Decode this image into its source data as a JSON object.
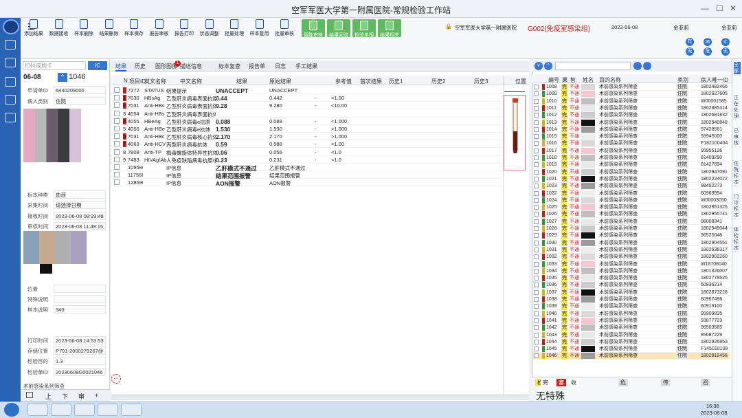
{
  "window": {
    "title": "空军军医大学第一附属医院-常规检验工作站",
    "controls": [
      "—",
      "☐",
      "✕"
    ]
  },
  "toolbar": {
    "buttons": [
      "添加结果",
      "数据接收",
      "样本删除",
      "结果删除",
      "样本保存",
      "报告审核",
      "报告打印",
      "状态调整",
      "批量处理",
      "样本复用",
      "批量审核",
      "智能审核",
      "结果回流",
      "检验单相关",
      "结果相关"
    ]
  },
  "infobar": {
    "hospital": "空军军医大学第一附属医院",
    "group": "G002(免疫室感染组)",
    "date": "2023-06-08",
    "user1": "金亚莉",
    "user2": "金亚莉",
    "status_buttons": [
      "在",
      "运",
      "正",
      "无",
      "危",
      "无"
    ]
  },
  "left": {
    "search_placeholder": "扫码或刷卡",
    "ic_label": "IC",
    "date": "06-08",
    "sample_no": "1046",
    "fields": [
      {
        "label": "申请单ID",
        "value": "6440209000"
      },
      {
        "label": "病人类别",
        "value": "住院"
      },
      {
        "label": "标本种类",
        "value": "血液"
      },
      {
        "label": "采集时间",
        "value": "请选择日期"
      },
      {
        "label": "接收时间",
        "value": "2023-06-08 08:29:48"
      },
      {
        "label": "审核时间",
        "value": "2023-06-08 11:49:15"
      },
      {
        "label": "位置",
        "value": ""
      },
      {
        "label": "特殊说明",
        "value": ""
      },
      {
        "label": "样本说明",
        "value": "340"
      },
      {
        "label": "打印时间",
        "value": "2023-06-08 14:53:53"
      },
      {
        "label": "存储位置",
        "value": "P701-2000279267@"
      },
      {
        "label": "检验目的",
        "value": "1.3"
      },
      {
        "label": "检验单ID",
        "value": "20230608G0021046"
      }
    ],
    "bottom_note": "术前感染系列筛查",
    "nav": [
      "上",
      "下",
      "审",
      "+"
    ]
  },
  "center": {
    "tabs": [
      "结果",
      "历史",
      "图形图像",
      "描述信息",
      "标本复查",
      "报告单",
      "日志",
      "手工结果"
    ],
    "badge": "1",
    "headers": [
      "N.",
      "项目ID",
      "英文名称",
      "中文名称",
      "结果",
      "原始结果",
      "",
      "参考值",
      "首次结果",
      "历史1",
      "历史2",
      "历史3",
      "位置"
    ],
    "rows": [
      {
        "n": "",
        "id": "7272",
        "en": "STATUS",
        "cn": "结果提示",
        "result": "UNACCEPT",
        "raw": "UNACCEPT",
        "flag": "",
        "ref": "",
        "mark": true
      },
      {
        "n": "1",
        "id": "7030",
        "en": "HBsAg",
        "cn": "乙型肝炎病毒表面抗原",
        "result": "0.44",
        "raw": "0.442",
        "flag": "-",
        "ref": "<1.00",
        "mark": true
      },
      {
        "n": "2",
        "id": "7031",
        "en": "Anti-HBs",
        "cn": "乙型肝炎病毒表面抗体",
        "result": "9.28",
        "raw": "9.280",
        "flag": "-",
        "ref": "<10.00",
        "mark": true
      },
      {
        "n": "3",
        "id": "4054",
        "en": "Anti-HBs",
        "cn": "乙型肝炎病毒表面抗体",
        "result": "",
        "raw": "",
        "flag": "",
        "ref": "",
        "mark": false
      },
      {
        "n": "4",
        "id": "4055",
        "en": "HBeAg",
        "cn": "乙型肝炎病毒e抗原",
        "result": "0.088",
        "raw": "0.088",
        "flag": "-",
        "ref": "<1.000",
        "mark": true
      },
      {
        "n": "5",
        "id": "4056",
        "en": "Anti-HBe",
        "cn": "乙型肝炎病毒e抗体",
        "result": "1.530",
        "raw": "1.530",
        "flag": "-",
        "ref": ">1.000",
        "mark": false
      },
      {
        "n": "6",
        "id": "7031",
        "en": "Anti-HBc",
        "cn": "乙型肝炎病毒核心抗体",
        "result": "2.170",
        "raw": "2.170",
        "flag": "-",
        "ref": ">1.000",
        "mark": true
      },
      {
        "n": "7",
        "id": "4063",
        "en": "Anti-HCV",
        "cn": "丙型肝炎病毒抗体",
        "result": "0.59",
        "raw": "0.588",
        "flag": "-",
        "ref": "<1.00",
        "mark": true
      },
      {
        "n": "8",
        "id": "7808",
        "en": "Anti-TP",
        "cn": "梅毒螺旋体特异性抗体",
        "result": "0.06",
        "raw": "0.056",
        "flag": "-",
        "ref": "<1.0",
        "mark": false
      },
      {
        "n": "9",
        "id": "7483",
        "en": "HIVAg/Ab",
        "cn": "人免疫缺陷病毒抗原/抗体",
        "result": "0.23",
        "raw": "0.231",
        "flag": "-",
        "ref": "<1.0",
        "mark": false
      },
      {
        "n": "",
        "id": "109586",
        "en": "",
        "cn": "IP信息",
        "result": "乙肝模式不通过",
        "raw": "乙肝模式不通过",
        "flag": "",
        "ref": "",
        "mark": false
      },
      {
        "n": "",
        "id": "117566",
        "en": "",
        "cn": "IP信息",
        "result": "结果范围报警",
        "raw": "结果范围报警",
        "flag": "",
        "ref": "",
        "mark": false
      },
      {
        "n": "",
        "id": "128590",
        "en": "",
        "cn": "IP信息",
        "result": "AON报警",
        "raw": "AON报警",
        "flag": "",
        "ref": "",
        "mark": false
      }
    ]
  },
  "right": {
    "headers": [
      "编号",
      "果",
      "智",
      "姓名",
      "目的名称",
      "类别",
      "病人唯一ID"
    ],
    "rows": [
      {
        "no": "1008",
        "r": "完",
        "s": "不通",
        "purpose": "术前感染系列筛查",
        "cat": "住院",
        "pid": "1802482466"
      },
      {
        "no": "1009",
        "r": "完",
        "s": "不通",
        "purpose": "术前感染系列筛查",
        "cat": "住院",
        "pid": "1802927605"
      },
      {
        "no": "1010",
        "r": "完",
        "s": "不通",
        "purpose": "术前感染系列筛查",
        "cat": "住院",
        "pid": "W00001585"
      },
      {
        "no": "1011",
        "r": "完",
        "s": "不通",
        "purpose": "术前感染系列筛查",
        "cat": "住院",
        "pid": "1802885314"
      },
      {
        "no": "1012",
        "r": "完",
        "s": "不通",
        "purpose": "术前感染系列筛查",
        "cat": "住院",
        "pid": "1802681832"
      },
      {
        "no": "1013",
        "r": "完",
        "s": "不通",
        "purpose": "术前感染系列筛查",
        "cat": "住院",
        "pid": "1802940848"
      },
      {
        "no": "1014",
        "r": "完",
        "s": "不通",
        "purpose": "术前感染系列筛查",
        "cat": "住院",
        "pid": "97428561"
      },
      {
        "no": "1015",
        "r": "完",
        "s": "不通",
        "purpose": "术前感染系列筛查",
        "cat": "住院",
        "pid": "93945000"
      },
      {
        "no": "1016",
        "r": "完",
        "s": "不通",
        "purpose": "术前感染系列筛查",
        "cat": "住院",
        "pid": "F182100404"
      },
      {
        "no": "1017",
        "r": "完",
        "s": "不通",
        "purpose": "术前感染系列筛查",
        "cat": "住院",
        "pid": "95955126"
      },
      {
        "no": "1018",
        "r": "完",
        "s": "不通",
        "purpose": "术前感染系列筛查",
        "cat": "住院",
        "pid": "81409290"
      },
      {
        "no": "1019",
        "r": "完",
        "s": "不通",
        "purpose": "术前感染系列筛查",
        "cat": "住院",
        "pid": "81427694"
      },
      {
        "no": "1020",
        "r": "完",
        "s": "不通",
        "purpose": "术前感染系列筛查",
        "cat": "住院",
        "pid": "1802947091"
      },
      {
        "no": "1021",
        "r": "完",
        "s": "不通",
        "purpose": "术前感染系列筛查",
        "cat": "住院",
        "pid": "1802224022"
      },
      {
        "no": "1023",
        "r": "完",
        "s": "不通",
        "purpose": "术前感染系列筛查",
        "cat": "住院",
        "pid": "98452273"
      },
      {
        "no": "1022",
        "r": "完",
        "s": "不通",
        "purpose": "术前感染系列筛查",
        "cat": "住院",
        "pid": "60969994"
      },
      {
        "no": "1024",
        "r": "完",
        "s": "不通",
        "purpose": "术前感染系列筛查",
        "cat": "住院",
        "pid": "W00003050"
      },
      {
        "no": "1025",
        "r": "完",
        "s": "不通",
        "purpose": "术前感染系列筛查",
        "cat": "住院",
        "pid": "1802951325"
      },
      {
        "no": "1026",
        "r": "完",
        "s": "不通",
        "purpose": "术前感染系列筛查",
        "cat": "住院",
        "pid": "1802955741"
      },
      {
        "no": "1027",
        "r": "完",
        "s": "不通",
        "purpose": "术前感染系列筛查",
        "cat": "住院",
        "pid": "98008341"
      },
      {
        "no": "1028",
        "r": "完",
        "s": "不通",
        "purpose": "术前感染系列筛查",
        "cat": "住院",
        "pid": "1802949044"
      },
      {
        "no": "1029",
        "r": "完",
        "s": "不通",
        "purpose": "术前感染系列筛查",
        "cat": "住院",
        "pid": "96525048"
      },
      {
        "no": "1030",
        "r": "完",
        "s": "不通",
        "purpose": "术前感染系列筛查",
        "cat": "住院",
        "pid": "1802904551"
      },
      {
        "no": "1031",
        "r": "完",
        "s": "不通",
        "purpose": "术前感染系列筛查",
        "cat": "住院",
        "pid": "1802936317"
      },
      {
        "no": "1032",
        "r": "完",
        "s": "不通",
        "purpose": "术前感染系列筛查",
        "cat": "住院",
        "pid": "1802902260"
      },
      {
        "no": "1033",
        "r": "完",
        "s": "不通",
        "purpose": "术前感染系列筛查",
        "cat": "住院",
        "pid": "W18708040"
      },
      {
        "no": "1034",
        "r": "完",
        "s": "不通",
        "purpose": "术前感染系列筛查",
        "cat": "住院",
        "pid": "1801326007"
      },
      {
        "no": "1035",
        "r": "完",
        "s": "不通",
        "purpose": "术前感染系列筛查",
        "cat": "住院",
        "pid": "1802778526"
      },
      {
        "no": "1036",
        "r": "完",
        "s": "不通",
        "purpose": "术前感染系列筛查",
        "cat": "住院",
        "pid": "60836214"
      },
      {
        "no": "1037",
        "r": "完",
        "s": "不通",
        "purpose": "术前感染系列筛查",
        "cat": "住院",
        "pid": "1802873228"
      },
      {
        "no": "1038",
        "r": "完",
        "s": "不通",
        "purpose": "术前感染系列筛查",
        "cat": "住院",
        "pid": "60967498"
      },
      {
        "no": "1039",
        "r": "完",
        "s": "不通",
        "purpose": "术前感染系列筛查",
        "cat": "住院",
        "pid": "60919100"
      },
      {
        "no": "1040",
        "r": "完",
        "s": "不通",
        "purpose": "术前感染系列筛查",
        "cat": "住院",
        "pid": "95909835"
      },
      {
        "no": "1041",
        "r": "完",
        "s": "不通",
        "purpose": "术前感染系列筛查",
        "cat": "住院",
        "pid": "93877723"
      },
      {
        "no": "1042",
        "r": "完",
        "s": "不通",
        "purpose": "术前感染系列筛查",
        "cat": "住院",
        "pid": "96503585"
      },
      {
        "no": "1043",
        "r": "完",
        "s": "不通",
        "purpose": "术前感染系列筛查",
        "cat": "住院",
        "pid": "95687229"
      },
      {
        "no": "1044",
        "r": "完",
        "s": "不通",
        "purpose": "术前感染系列筛查",
        "cat": "住院",
        "pid": "1802926853"
      },
      {
        "no": "1045",
        "r": "完",
        "s": "不通",
        "purpose": "术前感染系列筛查",
        "cat": "住院",
        "pid": "F145010109"
      },
      {
        "no": "1046",
        "r": "完",
        "s": "不通",
        "purpose": "术前感染系列筛查",
        "cat": "住院",
        "pid": "1802919456"
      }
    ],
    "footer": {
      "items": [
        "检",
        "完",
        "審",
        "收",
        "危",
        "传",
        "召"
      ],
      "note": "无特殊"
    },
    "side_tabs": [
      "全部",
      "正在处理",
      "已审核",
      "住院标本",
      "门诊标本",
      "体检标本"
    ]
  },
  "taskbar": {
    "time": "16:36",
    "date": "2023-06-08"
  }
}
